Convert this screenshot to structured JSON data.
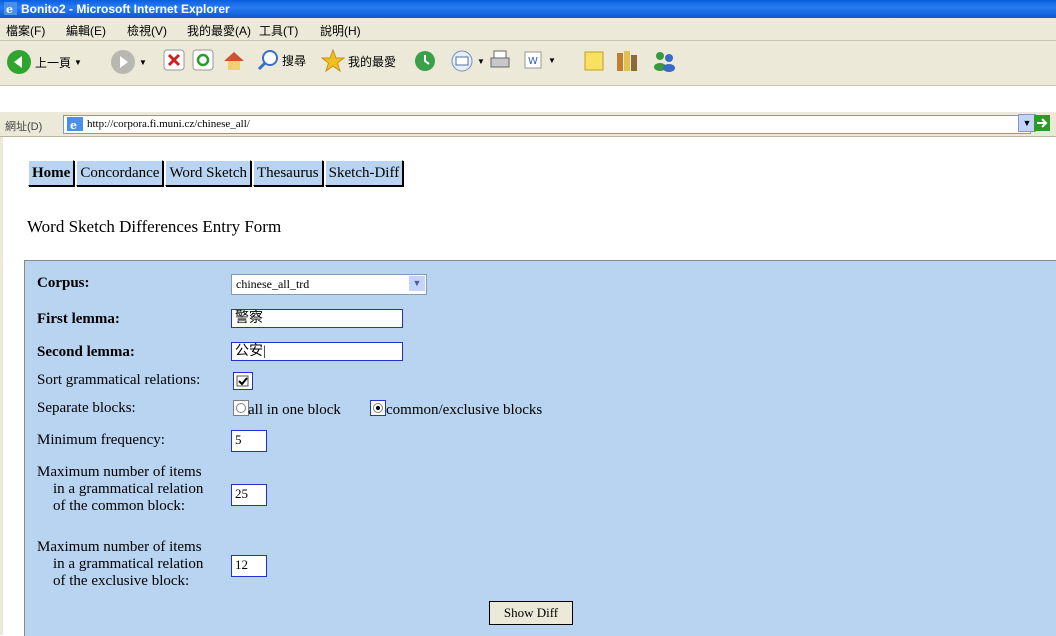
{
  "window": {
    "title": "Bonito2 - Microsoft Internet Explorer"
  },
  "menu": [
    "檔案(F)",
    "編輯(E)",
    "檢視(V)",
    "我的最愛(A)",
    "工具(T)",
    "說明(H)"
  ],
  "toolbar": {
    "back_label": "上一頁",
    "search_label": "搜尋",
    "favorites_label": "我的最愛"
  },
  "address": {
    "label": "網址(D)",
    "url": "http://corpora.fi.muni.cz/chinese_all/",
    "go_label": "移至"
  },
  "tabs": [
    "Home",
    "Concordance",
    "Word Sketch",
    "Thesaurus",
    "Sketch-Diff"
  ],
  "page_title": "Word Sketch Differences Entry Form",
  "form": {
    "corpus_label": "Corpus:",
    "corpus_value": "chinese_all_trd",
    "first_lemma_label": "First lemma:",
    "first_lemma_value": "警察",
    "second_lemma_label": "Second lemma:",
    "second_lemma_value": "公安|",
    "sort_label": "Sort grammatical relations:",
    "sort_checked": true,
    "separate_label": "Separate blocks:",
    "radio_all_label": "all in one block",
    "radio_common_label": "common/exclusive blocks",
    "min_freq_label": "Minimum frequency:",
    "min_freq_value": "5",
    "max_common_label_1": "Maximum number of items",
    "max_common_label_2": "in a grammatical relation",
    "max_common_label_3": "of the common block:",
    "max_common_value": "25",
    "max_excl_label_1": "Maximum number of items",
    "max_excl_label_2": "in a grammatical relation",
    "max_excl_label_3": "of the exclusive block:",
    "max_excl_value": "12",
    "submit_label": "Show Diff"
  }
}
